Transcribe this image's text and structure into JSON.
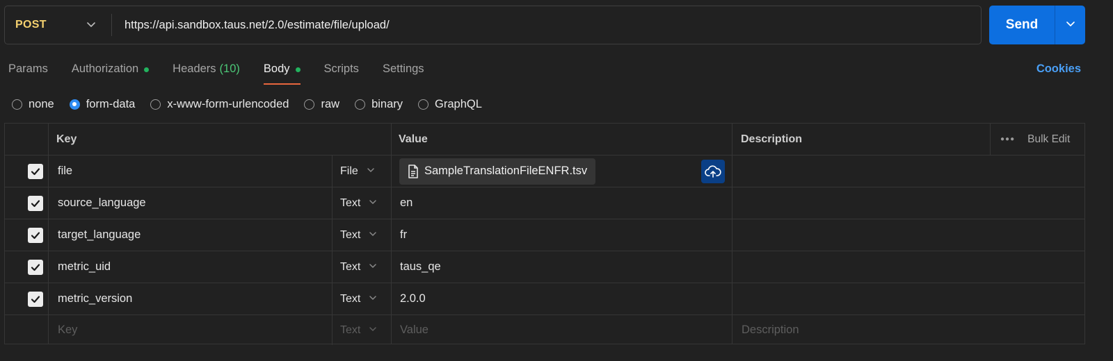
{
  "request": {
    "method": "POST",
    "url": "https://api.sandbox.taus.net/2.0/estimate/file/upload/",
    "send_label": "Send"
  },
  "tabs": [
    {
      "label": "Params",
      "active": false,
      "dot": false
    },
    {
      "label": "Authorization",
      "active": false,
      "dot": true
    },
    {
      "label": "Headers",
      "count": "(10)",
      "active": false,
      "dot": false
    },
    {
      "label": "Body",
      "active": true,
      "dot": true
    },
    {
      "label": "Scripts",
      "active": false,
      "dot": false
    },
    {
      "label": "Settings",
      "active": false,
      "dot": false
    }
  ],
  "cookies_label": "Cookies",
  "body_types": [
    {
      "label": "none",
      "selected": false
    },
    {
      "label": "form-data",
      "selected": true
    },
    {
      "label": "x-www-form-urlencoded",
      "selected": false
    },
    {
      "label": "raw",
      "selected": false
    },
    {
      "label": "binary",
      "selected": false
    },
    {
      "label": "GraphQL",
      "selected": false
    }
  ],
  "table": {
    "headers": {
      "key": "Key",
      "value": "Value",
      "description": "Description",
      "bulk_edit": "Bulk Edit"
    },
    "rows": [
      {
        "checked": true,
        "key": "file",
        "type": "File",
        "value": "SampleTranslationFileENFR.tsv",
        "is_file": true,
        "description": ""
      },
      {
        "checked": true,
        "key": "source_language",
        "type": "Text",
        "value": "en",
        "is_file": false,
        "description": ""
      },
      {
        "checked": true,
        "key": "target_language",
        "type": "Text",
        "value": "fr",
        "is_file": false,
        "description": ""
      },
      {
        "checked": true,
        "key": "metric_uid",
        "type": "Text",
        "value": "taus_qe",
        "is_file": false,
        "description": ""
      },
      {
        "checked": true,
        "key": "metric_version",
        "type": "Text",
        "value": "2.0.0",
        "is_file": false,
        "description": ""
      }
    ],
    "placeholder_row": {
      "key": "Key",
      "type": "Text",
      "value": "Value",
      "description": "Description"
    }
  },
  "colors": {
    "background": "#212121",
    "method": "#f4d06f",
    "send": "#0d6fe0",
    "active_tab_underline": "#e8663d",
    "status_dot": "#22b35e",
    "link": "#4a9ff5"
  }
}
